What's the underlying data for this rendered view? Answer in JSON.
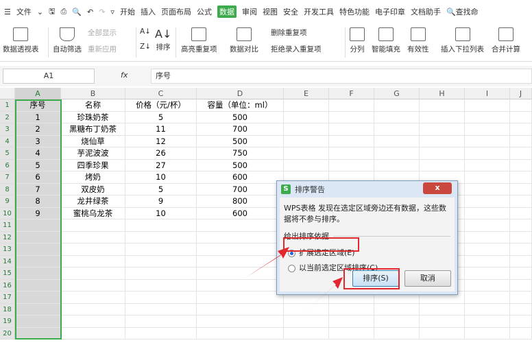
{
  "menubar": {
    "file": "文件",
    "tabs": [
      "开始",
      "插入",
      "页面布局",
      "公式",
      "数据",
      "审阅",
      "视图",
      "安全",
      "开发工具",
      "特色功能",
      "电子印章",
      "文档助手"
    ],
    "active_tab": "数据",
    "search": "查找命"
  },
  "ribbon": {
    "pivot": "数据透视表",
    "autofilter": "自动筛选",
    "show_all": "全部显示",
    "reapply": "重新应用",
    "sort": "排序",
    "highlight_dup": "高亮重复项",
    "compare": "数据对比",
    "remove_dup": "删除重复项",
    "reject_dup": "拒绝录入重复项",
    "split": "分列",
    "smart_fill": "智能填充",
    "validity": "有效性",
    "dropdown": "插入下拉列表",
    "consolidate": "合并计算"
  },
  "formula_bar": {
    "cell_ref": "A1",
    "fx": "fx",
    "value": "序号"
  },
  "columns": [
    "A",
    "B",
    "C",
    "D",
    "E",
    "F",
    "G",
    "H",
    "I",
    "J"
  ],
  "rows": [
    [
      "序号",
      "名称",
      "价格（元/杯）",
      "容量（单位：ml）"
    ],
    [
      "1",
      "珍珠奶茶",
      "5",
      "500"
    ],
    [
      "2",
      "黑糖布丁奶茶",
      "11",
      "700"
    ],
    [
      "3",
      "烧仙草",
      "12",
      "500"
    ],
    [
      "4",
      "芋泥波波",
      "26",
      "750"
    ],
    [
      "5",
      "四季珍果",
      "27",
      "500"
    ],
    [
      "6",
      "烤奶",
      "10",
      "600"
    ],
    [
      "7",
      "双皮奶",
      "5",
      "700"
    ],
    [
      "8",
      "龙井绿茶",
      "9",
      "800"
    ],
    [
      "9",
      "蜜桃乌龙茶",
      "10",
      "600"
    ]
  ],
  "row_count": 20,
  "dialog": {
    "title": "排序警告",
    "message": "WPS表格 发现在选定区域旁边还有数据，这些数据将不参与排序。",
    "group": "给出排序依据",
    "option1": "扩展选定区域(E)",
    "option2": "以当前选定区域排序(C)",
    "selected": "option1",
    "ok": "排序(S)",
    "cancel": "取消",
    "close": "x",
    "logo": "S"
  },
  "colors": {
    "accent": "#3daa4d",
    "highlight": "#e0282e"
  }
}
